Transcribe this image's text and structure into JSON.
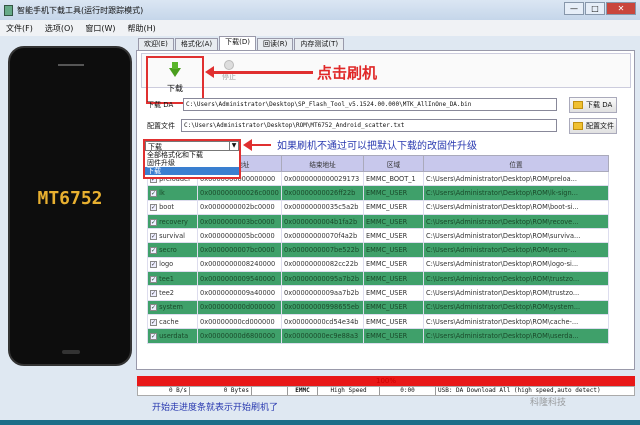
{
  "window": {
    "title": "智能手机下载工具(运行时跟踪模式)",
    "buttons": [
      "—",
      "□",
      "✕"
    ]
  },
  "menu": [
    "文件(F)",
    "选项(O)",
    "窗口(W)",
    "帮助(H)"
  ],
  "phone": {
    "model": "MT6752"
  },
  "tabs": [
    "欢迎(E)",
    "格式化(A)",
    "下载(D)",
    "回读(R)",
    "内存测试(T)"
  ],
  "toolbar": {
    "download": "下载",
    "stop": "停止"
  },
  "annotations": {
    "click": "点击刷机",
    "dropdown": "如果刷机不通过可以把默认下载的改固件升级",
    "progress": "开始走进度条就表示开始刷机了"
  },
  "da": {
    "label": "下载 DA",
    "value": "C:\\Users\\Administrator\\Desktop\\SP_Flash_Tool_v5.1524.00.000\\MTK_AllInOne_DA.bin",
    "button": "下载 DA"
  },
  "scatter": {
    "label": "配置文件",
    "value": "C:\\Users\\Administrator\\Desktop\\ROM\\MT6752_Android_scatter.txt",
    "button": "配置文件"
  },
  "mode": {
    "selected": "下载",
    "options": [
      "全部格式化和下载",
      "固件升级",
      "下载"
    ]
  },
  "table": {
    "headers": [
      "",
      "始地址",
      "结束地址",
      "区域",
      "位置"
    ],
    "rows": [
      [
        "preloader",
        "0x0000000000000000",
        "0x0000000000029173",
        "EMMC_BOOT_1",
        "C:\\Users\\Administrator\\Desktop\\ROM\\preloa..."
      ],
      [
        "lk",
        "0x000000000026c0000",
        "0x00000000026ff22b",
        "EMMC_USER",
        "C:\\Users\\Administrator\\Desktop\\ROM\\lk-sign..."
      ],
      [
        "boot",
        "0x0000000002bc0000",
        "0x00000000035c5a2b",
        "EMMC_USER",
        "C:\\Users\\Administrator\\Desktop\\ROM\\boot-si..."
      ],
      [
        "recovery",
        "0x0000000003bc0000",
        "0x0000000004b1fa2b",
        "EMMC_USER",
        "C:\\Users\\Administrator\\Desktop\\ROM\\recove..."
      ],
      [
        "survival",
        "0x0000000005bc0000",
        "0x00000000070f4a2b",
        "EMMC_USER",
        "C:\\Users\\Administrator\\Desktop\\ROM\\surviva..."
      ],
      [
        "secro",
        "0x0000000007bc0000",
        "0x0000000007be522b",
        "EMMC_USER",
        "C:\\Users\\Administrator\\Desktop\\ROM\\secro-..."
      ],
      [
        "logo",
        "0x0000000008240000",
        "0x00000000082cc22b",
        "EMMC_USER",
        "C:\\Users\\Administrator\\Desktop\\ROM\\logo-si..."
      ],
      [
        "tee1",
        "0x0000000009540000",
        "0x00000000095a7b2b",
        "EMMC_USER",
        "C:\\Users\\Administrator\\Desktop\\ROM\\trustzo..."
      ],
      [
        "tee2",
        "0x0000000009a40000",
        "0x0000000009aa7b2b",
        "EMMC_USER",
        "C:\\Users\\Administrator\\Desktop\\ROM\\trustzo..."
      ],
      [
        "system",
        "0x000000000d000000",
        "0x00000000998655eb",
        "EMMC_USER",
        "C:\\Users\\Administrator\\Desktop\\ROM\\system..."
      ],
      [
        "cache",
        "0x00000000cd000000",
        "0x00000000cd54e34b",
        "EMMC_USER",
        "C:\\Users\\Administrator\\Desktop\\ROM\\cache-..."
      ],
      [
        "userdata",
        "0x00000000d6800000",
        "0x00000000ec9e88a3",
        "EMMC_USER",
        "C:\\Users\\Administrator\\Desktop\\ROM\\userda..."
      ]
    ]
  },
  "progress": {
    "percent": 100,
    "label": "100%"
  },
  "status": [
    "0 B/s",
    "0 Bytes",
    "",
    "EMMC",
    "High Speed",
    "0:00",
    "USB: DA Download All (high speed,auto detect)"
  ],
  "watermark": "科隆科技"
}
